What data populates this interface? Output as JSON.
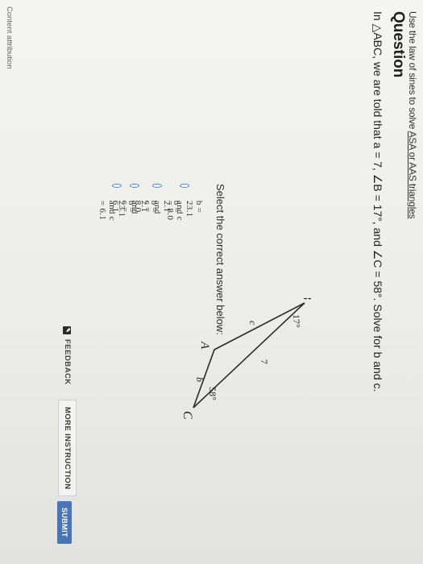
{
  "header": {
    "topic_prefix": "Use the law of sines to solve ",
    "topic_link": "ASA or AAS triangles",
    "question_heading": "Question"
  },
  "question": {
    "text_prefix": "In △ABC, we are told that ",
    "text_body": "a = 7, ∠B = 17°, and ∠C = 58°. Solve for b and c."
  },
  "diagram": {
    "vertex_B": "B",
    "vertex_C": "C",
    "vertex_A": "A",
    "angle_B": "17°",
    "angle_C": "58°",
    "side_a": "7",
    "side_b": "b",
    "side_c": "c",
    "stroke_color": "#2a2a2a"
  },
  "prompt": {
    "select_label": "Select the correct answer below:"
  },
  "answers": [
    {
      "label": "b = 23.1 and c = 8.0"
    },
    {
      "label": "b = 2.1 and c = 8.0"
    },
    {
      "label": "b = 2.1 and c = 6.1"
    },
    {
      "label": "b = 23.1 and c = 6.1"
    }
  ],
  "footer": {
    "content_attribution": "Content attribution",
    "feedback_label": "FEEDBACK",
    "more_instruction_label": "MORE INSTRUCTION",
    "submit_label": "SUBMIT"
  },
  "colors": {
    "accent": "#4a74b8",
    "radio_border": "#4f86c6"
  },
  "icons": {
    "feedback": "feedback-icon",
    "radio": "radio-circle-icon"
  }
}
